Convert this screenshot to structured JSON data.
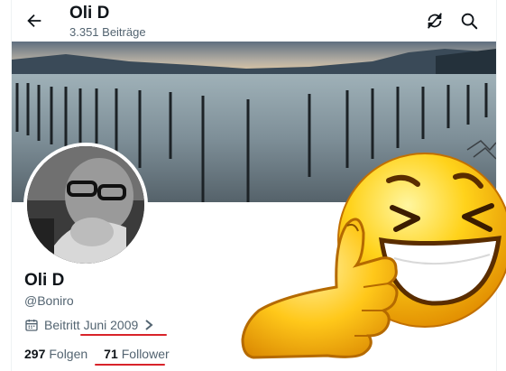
{
  "header": {
    "title": "Oli D",
    "post_count": "3.351 Beiträge"
  },
  "profile": {
    "name": "Oli D",
    "handle": "@Boniro",
    "joined": "Beitritt Juni 2009",
    "following_count": "297",
    "following_label": "Folgen",
    "followers_count": "71",
    "followers_label": "Follower"
  },
  "icons": {
    "back": "back-arrow-icon",
    "sync": "sync-off-icon",
    "search": "search-icon",
    "calendar": "calendar-icon",
    "chevron": "chevron-right-icon"
  },
  "colors": {
    "text": "#0f1419",
    "muted": "#536471",
    "annotation": "#d8232a"
  }
}
